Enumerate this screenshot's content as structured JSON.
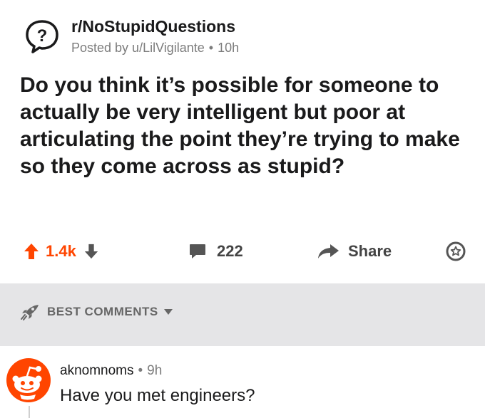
{
  "post": {
    "subreddit": "r/NoStupidQuestions",
    "posted_by": "Posted by u/LilVigilante",
    "age": "10h",
    "title": "Do you think it’s possible for someone to actually be very intelligent but poor at articulating the point they’re trying to make so they come across as stupid?"
  },
  "actions": {
    "upvotes": "1.4k",
    "comments": "222",
    "share": "Share"
  },
  "sort": {
    "label": "BEST COMMENTS"
  },
  "comment": {
    "author": "aknomnoms",
    "age": "9h",
    "body": "Have you met engineers?"
  },
  "colors": {
    "upvote": "#ff4500",
    "band": "#e5e5e7",
    "avatar": "#ff4500"
  },
  "icons": [
    "question-mark-icon",
    "upvote-arrow-icon",
    "downvote-arrow-icon",
    "comment-icon",
    "share-arrow-icon",
    "award-icon",
    "rocket-icon",
    "chevron-down-icon",
    "snoo-avatar-icon"
  ]
}
